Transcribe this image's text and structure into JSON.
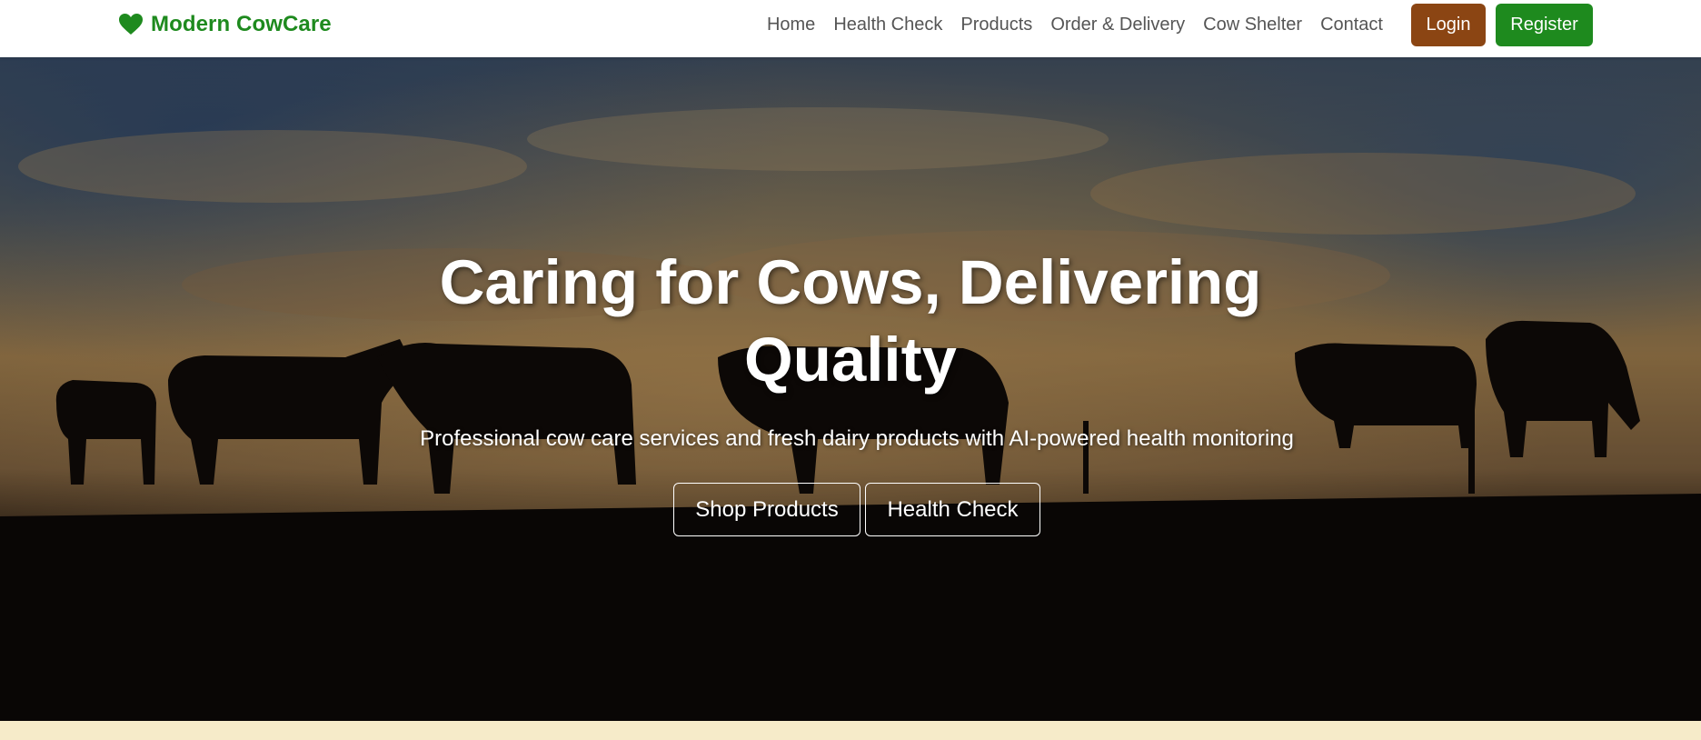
{
  "brand": {
    "name": "Modern CowCare",
    "icon": "heart-icon",
    "color": "#1e8a1e"
  },
  "nav": {
    "links": [
      "Home",
      "Health Check",
      "Products",
      "Order & Delivery",
      "Cow Shelter",
      "Contact"
    ],
    "login_label": "Login",
    "register_label": "Register"
  },
  "hero": {
    "title": "Caring for Cows, Delivering Quality",
    "subtitle": "Professional cow care services and fresh dairy products with AI-powered health monitoring",
    "primary_cta": "Shop Products",
    "secondary_cta": "Health Check"
  },
  "colors": {
    "brand_green": "#1e8a1e",
    "login_brown": "#8b4513",
    "nav_text": "#555555",
    "footer_strip": "#f6ebc9"
  }
}
